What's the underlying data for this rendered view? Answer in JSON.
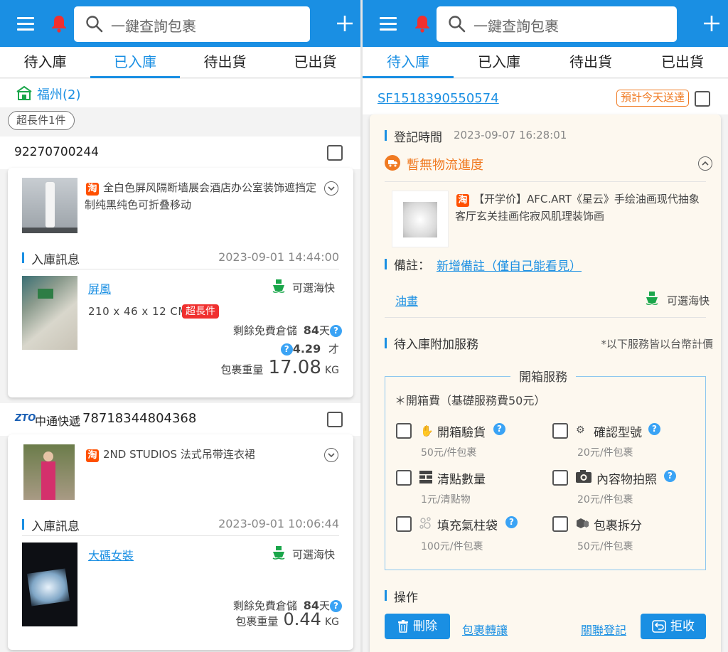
{
  "left": {
    "search_placeholder": "一鍵查詢包裹",
    "tabs": [
      "待入庫",
      "已入庫",
      "待出貨",
      "已出貨"
    ],
    "active_tab": 1,
    "location": "福州(2)",
    "filter_chip": "超長件1件",
    "packages": [
      {
        "tracking": "92270700244",
        "carrier": "",
        "product_title": "全白色屏风隔断墙展会酒店办公室装饰遮挡定制纯黑纯色可折叠移动",
        "section_title": "入庫訊息",
        "date": "2023-09-01 14:44:00",
        "item_name": "屏風",
        "shipping": "可選海快",
        "dimensions": "210 x 46 x 12 CM",
        "badge": "超長件",
        "storage_label": "剩餘免費倉儲",
        "storage_days": "84",
        "storage_unit": "天",
        "volume": "4.29",
        "volume_unit": "才",
        "weight_label": "包裹重量",
        "weight": "17.08",
        "weight_unit": "KG"
      },
      {
        "tracking": "78718344804368",
        "carrier": "中通快遞",
        "product_title": "2ND STUDIOS 法式吊带连衣裙",
        "section_title": "入庫訊息",
        "date": "2023-09-01 10:06:44",
        "item_name": "大碼女裝",
        "shipping": "可選海快",
        "storage_label": "剩餘免費倉儲",
        "storage_days": "84",
        "storage_unit": "天",
        "weight_label": "包裹重量",
        "weight": "0.44",
        "weight_unit": "KG"
      }
    ]
  },
  "right": {
    "search_placeholder": "一鍵查詢包裹",
    "tabs": [
      "待入庫",
      "已入庫",
      "待出貨",
      "已出貨"
    ],
    "active_tab": 0,
    "tracking": "SF1518390550574",
    "eta_badge": "預計今天送達",
    "register_label": "登記時間",
    "register_time": "2023-09-07 16:28:01",
    "logistics_status": "暫無物流進度",
    "product_title": "【开学价】AFC.ART《星云》手绘油画现代抽象客厅玄关挂画侘寂风肌理装饰画",
    "note_label": "備註：",
    "note_link": "新增備註（僅自己能看見）",
    "category": "油畫",
    "shipping": "可選海快",
    "addon_title": "待入庫附加服務",
    "addon_note": "*以下服務皆以台幣計價",
    "service_box_title": "開箱服務",
    "service_fee": "＊開箱費（基礎服務費50元）",
    "services": [
      {
        "name": "開箱驗貨",
        "price": "50元/件包裹",
        "help": true
      },
      {
        "name": "確認型號",
        "price": "20元/件包裹",
        "help": true
      },
      {
        "name": "清點數量",
        "price": "1元/清點物",
        "help": false
      },
      {
        "name": "內容物拍照",
        "price": "20元/件包裹",
        "help": true
      },
      {
        "name": "填充氣柱袋",
        "price": "100元/件包裹",
        "help": true
      },
      {
        "name": "包裹拆分",
        "price": "50元/件包裹",
        "help": false
      }
    ],
    "ops_title": "操作",
    "delete_label": "刪除",
    "transfer_label": "包裹轉讓",
    "link_register_label": "關聯登記",
    "reject_label": "拒收"
  },
  "colors": {
    "primary": "#1a8fe3",
    "badge_red": "#f0302f",
    "eta_orange": "#f07a22",
    "taobao": "#ff5000",
    "ship_green": "#1aa64a"
  }
}
